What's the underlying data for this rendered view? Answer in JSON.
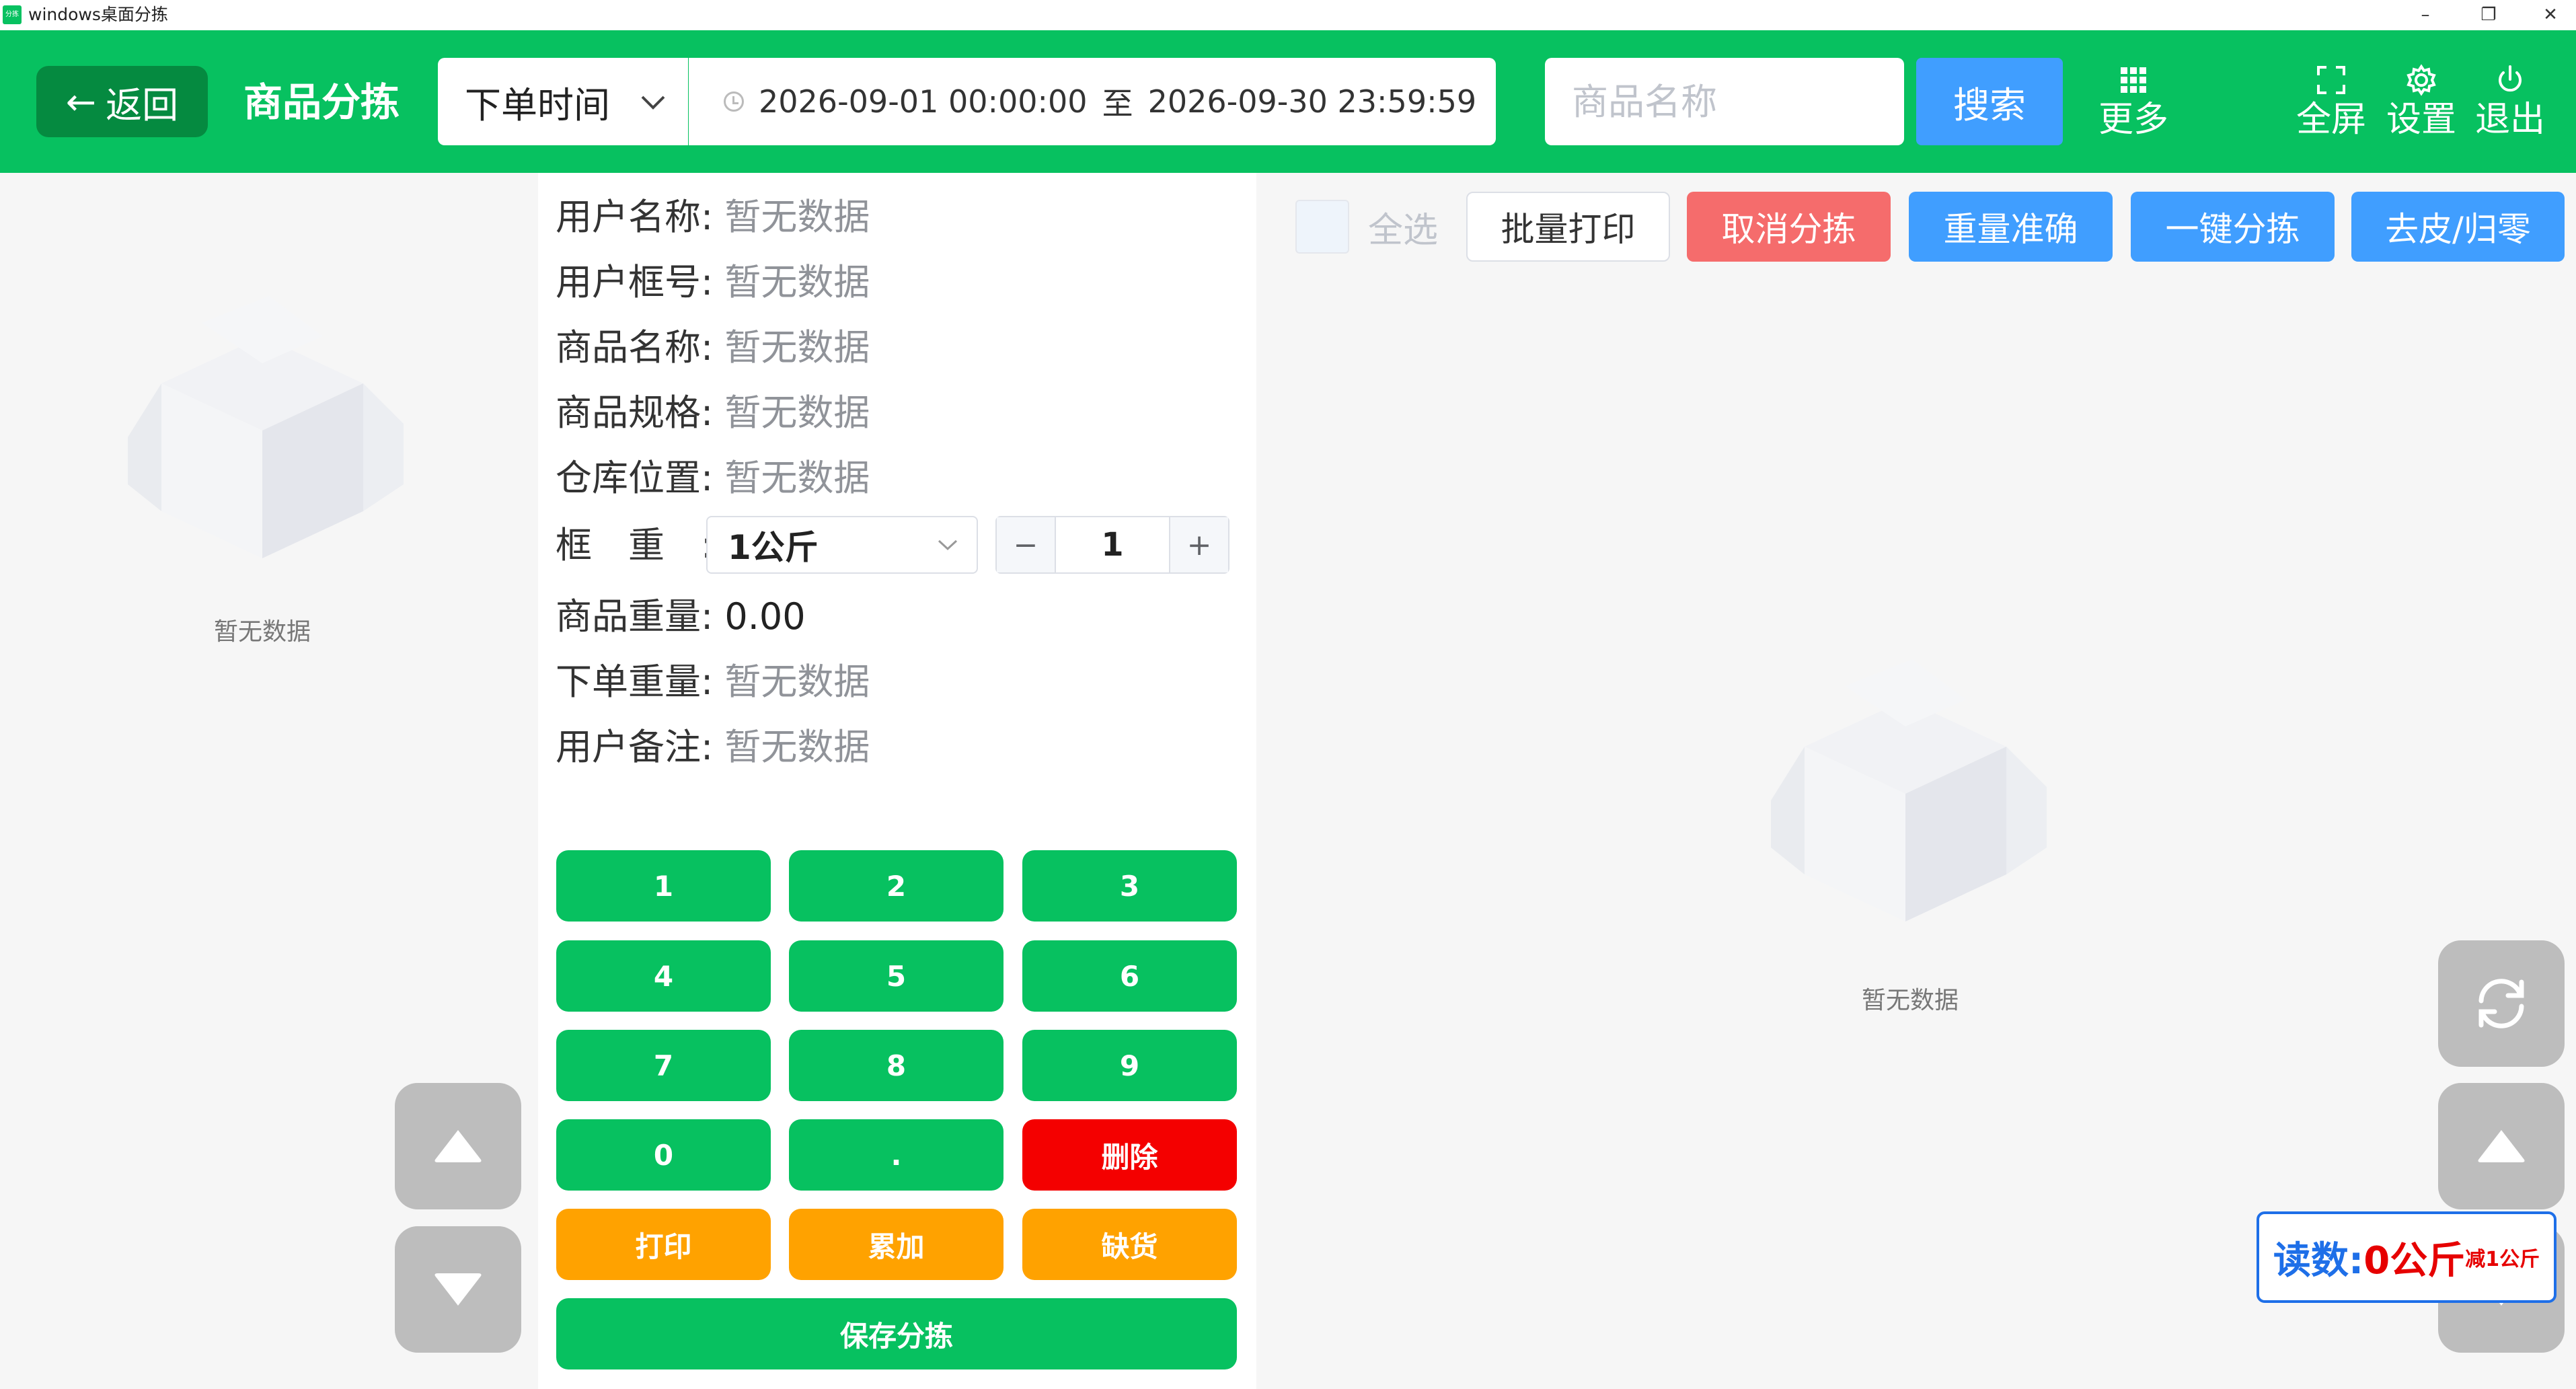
{
  "window": {
    "title": "windows桌面分拣",
    "app_icon_text": "分拣",
    "minimize": "–",
    "restore": "❐",
    "close": "✕"
  },
  "header": {
    "back_label": "返回",
    "title": "商品分拣",
    "time_type": "下单时间",
    "date_start": "2026-09-01 00:00:00",
    "date_sep": "至",
    "date_end": "2026-09-30 23:59:59",
    "search_placeholder": "商品名称",
    "search_label": "搜索",
    "more_label": "更多",
    "fullscreen_label": "全屏",
    "settings_label": "设置",
    "exit_label": "退出"
  },
  "left": {
    "empty_text": "暂无数据"
  },
  "info": {
    "rows": [
      {
        "label": "用户名称:",
        "value": "暂无数据"
      },
      {
        "label": "用户框号:",
        "value": "暂无数据"
      },
      {
        "label": "商品名称:",
        "value": "暂无数据"
      },
      {
        "label": "商品规格:",
        "value": "暂无数据"
      },
      {
        "label": "仓库位置:",
        "value": "暂无数据"
      }
    ],
    "frame_label": "框　重　:",
    "frame_value": "1公斤",
    "qty_minus": "−",
    "qty_value": "1",
    "qty_plus": "+",
    "rows2": [
      {
        "label": "商品重量:",
        "value": "0.00"
      },
      {
        "label": "下单重量:",
        "value": "暂无数据"
      },
      {
        "label": "用户备注:",
        "value": "暂无数据"
      }
    ]
  },
  "keypad": {
    "keys": [
      "1",
      "2",
      "3",
      "4",
      "5",
      "6",
      "7",
      "8",
      "9",
      "0",
      ".",
      "删除",
      "打印",
      "累加",
      "缺货"
    ],
    "save": "保存分拣"
  },
  "right": {
    "select_all": "全选",
    "actions": [
      "批量打印",
      "取消分拣",
      "重量准确",
      "一键分拣",
      "去皮/归零"
    ],
    "empty_text": "暂无数据",
    "reading_label": "读数:",
    "reading_value": "0公斤",
    "reading_note": "减1公斤"
  },
  "colors": {
    "brand_green": "#07c160",
    "header_dark_green": "#058a40",
    "primary_blue": "#409eff",
    "danger_red": "#f56c6c",
    "key_red": "#f40000",
    "key_orange": "#ffa200",
    "reading_blue": "#1e6fe8",
    "reading_red": "#e60000"
  },
  "icons": [
    "back-arrow-icon",
    "chevron-down-icon",
    "clock-icon",
    "grid-icon",
    "fullscreen-icon",
    "gear-icon",
    "power-icon",
    "refresh-icon",
    "caret-up-icon",
    "caret-down-icon",
    "empty-box-icon"
  ]
}
